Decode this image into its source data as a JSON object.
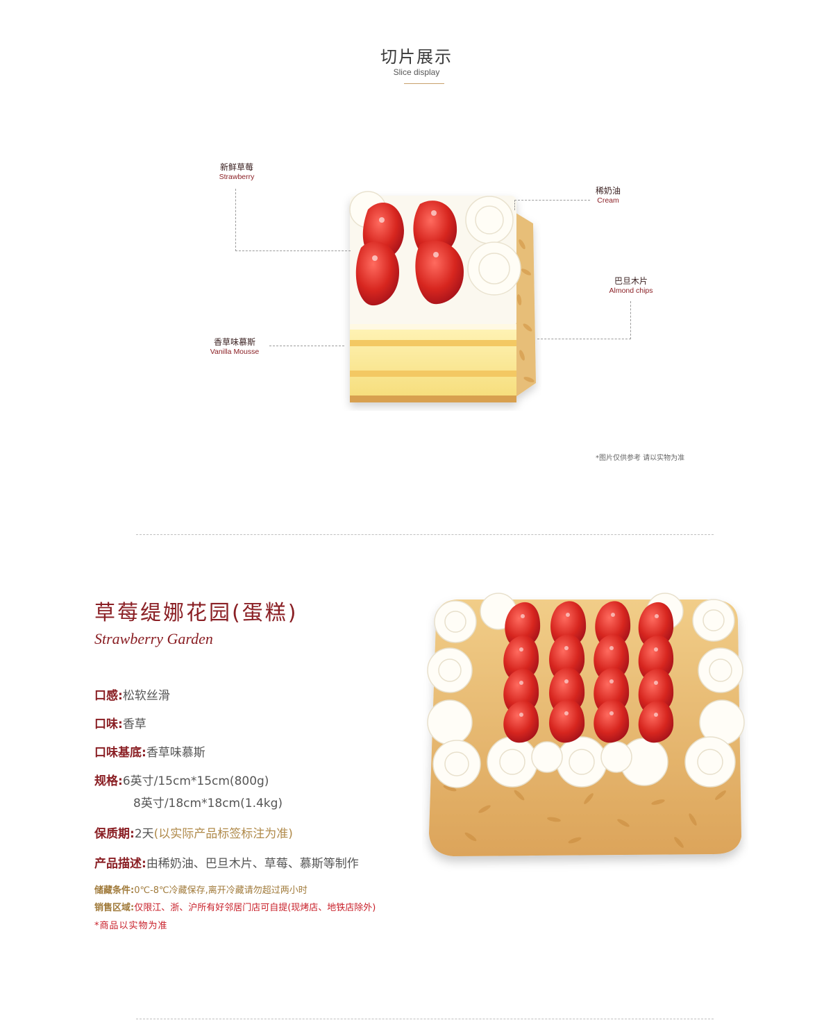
{
  "section": {
    "title": "切片展示",
    "subtitle": "Slice display"
  },
  "slice_labels": {
    "strawberry": {
      "cn": "新鲜草莓",
      "en": "Strawberry"
    },
    "cream": {
      "cn": "稀奶油",
      "en": "Cream"
    },
    "almond": {
      "cn": "巴旦木片",
      "en": "Almond chips"
    },
    "mousse": {
      "cn": "香草味慕斯",
      "en": "Vanilla Mousse"
    }
  },
  "slice_note": "*图片仅供参考 请以实物为准",
  "product": {
    "title": "草莓缇娜花园(蛋糕)",
    "title_en": "Strawberry Garden",
    "texture_key": "口感:",
    "texture_val": "松软丝滑",
    "flavor_key": "口味:",
    "flavor_val": "香草",
    "base_key": "口味基底:",
    "base_val": "香草味慕斯",
    "spec_key": "规格:",
    "spec_val_1": "6英寸/15cm*15cm(800g)",
    "spec_val_2": "8英寸/18cm*18cm(1.4kg)",
    "shelf_key": "保质期:",
    "shelf_val": "2天",
    "shelf_note": "(以实际产品标签标注为准)",
    "desc_key": "产品描述:",
    "desc_val": "由稀奶油、巴旦木片、草莓、慕斯等制作",
    "storage_key": "储藏条件:",
    "storage_val": "0℃-8℃冷藏保存,离开冷藏请勿超过两小时",
    "area_key": "销售区域:",
    "area_val": "仅限江、浙、沪所有好邻居门店可自提(现烤店、地铁店除外)",
    "disclaimer": "*商品以实物为准"
  },
  "colors": {
    "brand_red": "#8a1f24",
    "gold": "#c8a06a",
    "strawberry": "#d42a2a",
    "cream": "#fbf8ee",
    "almond": "#e6b86a"
  }
}
